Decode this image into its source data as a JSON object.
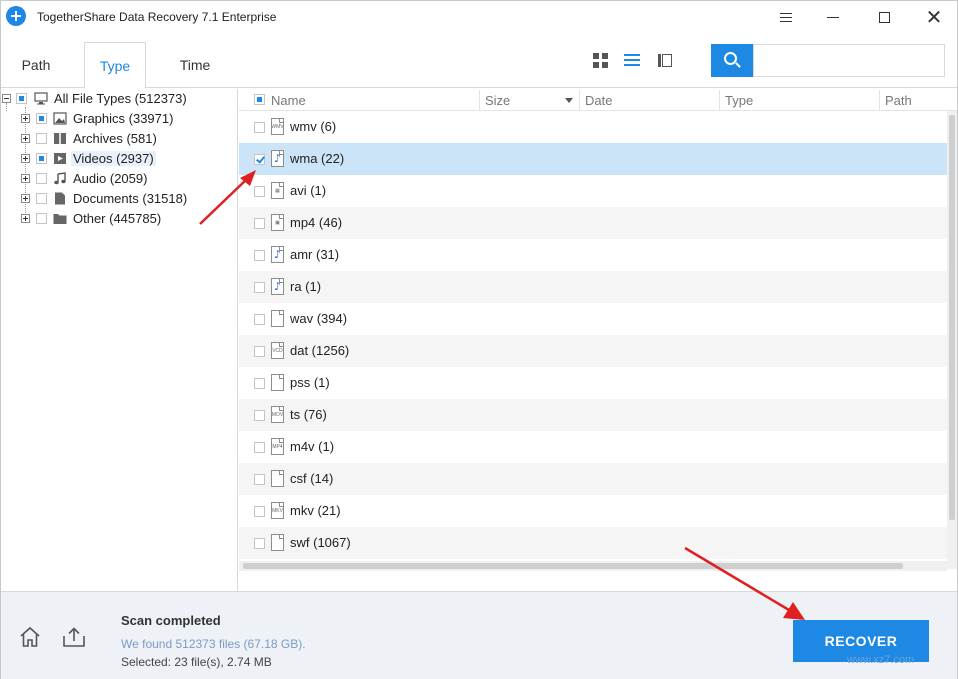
{
  "window": {
    "title": "TogetherShare Data Recovery 7.1 Enterprise"
  },
  "tabs": [
    {
      "label": "Path",
      "active": false
    },
    {
      "label": "Type",
      "active": true
    },
    {
      "label": "Time",
      "active": false
    }
  ],
  "search": {
    "value": "",
    "placeholder": ""
  },
  "tree": {
    "root": {
      "label": "All File Types (512373)"
    },
    "items": [
      {
        "label": "Graphics (33971)",
        "icon": "image-icon",
        "state": "partial"
      },
      {
        "label": "Archives (581)",
        "icon": "archive-icon",
        "state": "unchecked"
      },
      {
        "label": "Videos (2937)",
        "icon": "video-icon",
        "state": "partial",
        "highlighted": true
      },
      {
        "label": "Audio (2059)",
        "icon": "music-icon",
        "state": "unchecked"
      },
      {
        "label": "Documents (31518)",
        "icon": "document-icon",
        "state": "unchecked"
      },
      {
        "label": "Other (445785)",
        "icon": "folder-icon",
        "state": "unchecked"
      }
    ]
  },
  "columns": {
    "name": "Name",
    "size": "Size",
    "date": "Date",
    "type": "Type",
    "path": "Path"
  },
  "files": [
    {
      "label": "wmv (6)",
      "icon": "video-file-icon",
      "icon_text": "WMV",
      "checked": false,
      "selected": false
    },
    {
      "label": "wma (22)",
      "icon": "audio-file-icon",
      "icon_text": "♪",
      "checked": true,
      "selected": true
    },
    {
      "label": "avi (1)",
      "icon": "video-file-icon",
      "icon_text": "▦",
      "checked": false,
      "selected": false
    },
    {
      "label": "mp4 (46)",
      "icon": "video-file-icon",
      "icon_text": "▣",
      "checked": false,
      "selected": false
    },
    {
      "label": "amr (31)",
      "icon": "audio-file-icon",
      "icon_text": "♪",
      "checked": false,
      "selected": false
    },
    {
      "label": "ra (1)",
      "icon": "audio-file-icon",
      "icon_text": "♪",
      "checked": false,
      "selected": false
    },
    {
      "label": "wav (394)",
      "icon": "blank-file-icon",
      "icon_text": "",
      "checked": false,
      "selected": false
    },
    {
      "label": "dat (1256)",
      "icon": "video-file-icon",
      "icon_text": "VCD",
      "checked": false,
      "selected": false
    },
    {
      "label": "pss (1)",
      "icon": "blank-file-icon",
      "icon_text": "",
      "checked": false,
      "selected": false
    },
    {
      "label": "ts (76)",
      "icon": "video-file-icon",
      "icon_text": "MOV",
      "checked": false,
      "selected": false
    },
    {
      "label": "m4v (1)",
      "icon": "video-file-icon",
      "icon_text": "MP4",
      "checked": false,
      "selected": false
    },
    {
      "label": "csf (14)",
      "icon": "blank-file-icon",
      "icon_text": "",
      "checked": false,
      "selected": false
    },
    {
      "label": "mkv (21)",
      "icon": "video-file-icon",
      "icon_text": "MKV",
      "checked": false,
      "selected": false
    },
    {
      "label": "swf (1067)",
      "icon": "blank-file-icon",
      "icon_text": "",
      "checked": false,
      "selected": false
    }
  ],
  "footer": {
    "status_title": "Scan completed",
    "found_text": "We found 512373 files (67.18 GB).",
    "selected_text": "Selected: 23 file(s), 2.74 MB",
    "recover_label": "RECOVER",
    "watermark": "www.xz7.com"
  },
  "colors": {
    "accent": "#1e88e5",
    "selected_row": "#cce4f7",
    "annotation_arrow": "#e02020"
  }
}
